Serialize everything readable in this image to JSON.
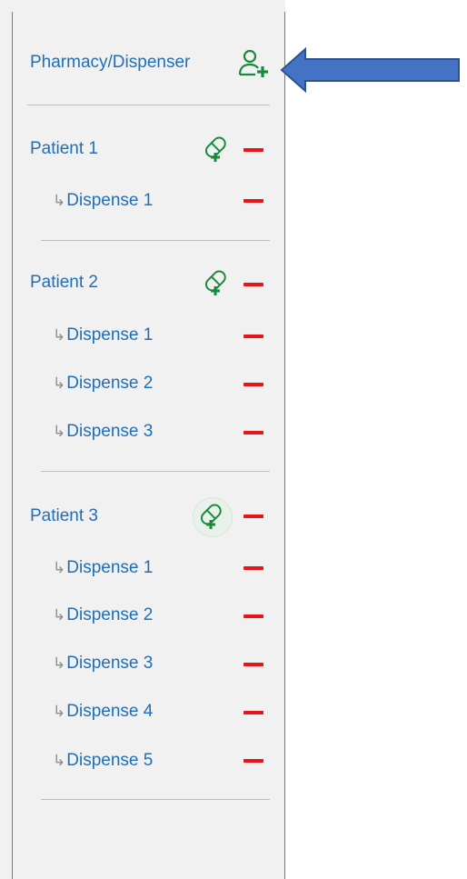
{
  "header": {
    "label": "Pharmacy/Dispenser",
    "add_icon": "person-plus-icon",
    "accent_color": "#1a8a3c"
  },
  "patients": [
    {
      "label": "Patient 1",
      "dispenses": [
        "Dispense 1"
      ]
    },
    {
      "label": "Patient 2",
      "dispenses": [
        "Dispense 1",
        "Dispense 2",
        "Dispense 3"
      ]
    },
    {
      "label": "Patient 3",
      "dispenses": [
        "Dispense 1",
        "Dispense 2",
        "Dispense 3",
        "Dispense 4",
        "Dispense 5"
      ]
    }
  ],
  "sub_item_prefix": "↳",
  "colors": {
    "link": "#1f6fb8",
    "remove": "#e8141a",
    "add_pill": "#1a8a3c",
    "callout_arrow": "#4472c4"
  }
}
